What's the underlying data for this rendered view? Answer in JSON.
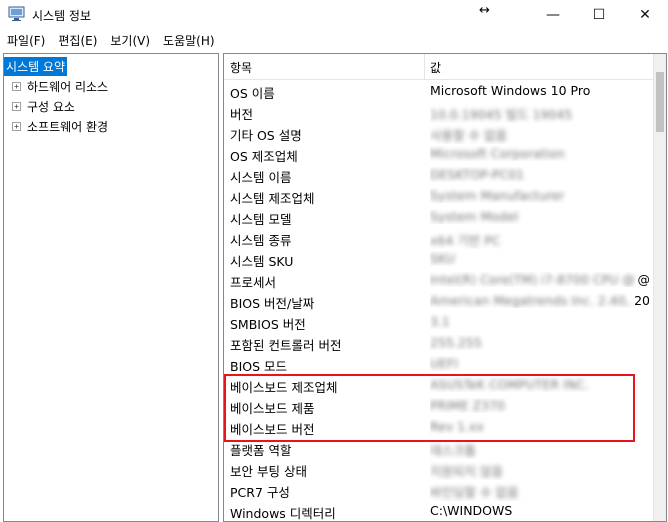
{
  "window": {
    "title": "시스템 정보",
    "icon": "system-info-icon",
    "resize_glyph": "↔",
    "minimize_glyph": "—",
    "maximize_glyph": "☐",
    "close_glyph": "✕"
  },
  "menu": [
    "파일(F)",
    "편집(E)",
    "보기(V)",
    "도움말(H)"
  ],
  "tree": [
    {
      "label": "시스템 요약",
      "selected": true,
      "expander": ""
    },
    {
      "label": "하드웨어 리소스",
      "selected": false,
      "expander": "+"
    },
    {
      "label": "구성 요소",
      "selected": false,
      "expander": "+"
    },
    {
      "label": "소프트웨어 환경",
      "selected": false,
      "expander": "+"
    }
  ],
  "list": {
    "headers": {
      "item": "항목",
      "value": "값"
    },
    "rows": [
      {
        "name": "OS 이름",
        "value": "Microsoft Windows 10 Pro",
        "redacted": false
      },
      {
        "name": "버전",
        "value": "10.0.19045 빌드 19045",
        "redacted": true
      },
      {
        "name": "기타 OS 설명",
        "value": "사용할 수 없음",
        "redacted": true
      },
      {
        "name": "OS 제조업체",
        "value": "Microsoft Corporation",
        "redacted": true
      },
      {
        "name": "시스템 이름",
        "value": "DESKTOP-PC01",
        "redacted": true
      },
      {
        "name": "시스템 제조업체",
        "value": "System Manufacturer",
        "redacted": true
      },
      {
        "name": "시스템 모델",
        "value": "System Model",
        "redacted": true
      },
      {
        "name": "시스템 종류",
        "value": "x64 기반 PC",
        "redacted": true
      },
      {
        "name": "시스템 SKU",
        "value": "SKU",
        "redacted": true
      },
      {
        "name": "프로세서",
        "value": "Intel(R) Core(TM) i7-8700 CPU @",
        "redacted": true,
        "visible_suffix": "@"
      },
      {
        "name": "BIOS 버전/날짜",
        "value": "American Megatrends Inc. 2.40, 20",
        "redacted": true,
        "visible_suffix": "20"
      },
      {
        "name": "SMBIOS 버전",
        "value": "3.1",
        "redacted": true
      },
      {
        "name": "포함된 컨트롤러 버전",
        "value": "255.255",
        "redacted": true
      },
      {
        "name": "BIOS 모드",
        "value": "UEFI",
        "redacted": true
      },
      {
        "name": "베이스보드 제조업체",
        "value": "ASUSTeK COMPUTER INC.",
        "redacted": true
      },
      {
        "name": "베이스보드 제품",
        "value": "PRIME Z370",
        "redacted": true
      },
      {
        "name": "베이스보드 버전",
        "value": "Rev 1.xx",
        "redacted": true
      },
      {
        "name": "플랫폼 역할",
        "value": "데스크톱",
        "redacted": true
      },
      {
        "name": "보안 부팅 상태",
        "value": "지원되지 않음",
        "redacted": true
      },
      {
        "name": "PCR7 구성",
        "value": "바인딩할 수 없음",
        "redacted": true
      },
      {
        "name": "Windows 디렉터리",
        "value": "C:\\WINDOWS",
        "redacted": false
      }
    ]
  },
  "highlight": {
    "color": "#e8141b",
    "covers": [
      "베이스보드 제조업체",
      "베이스보드 제품",
      "베이스보드 버전"
    ]
  },
  "colors": {
    "selection": "#0078d7",
    "border": "#828790"
  }
}
